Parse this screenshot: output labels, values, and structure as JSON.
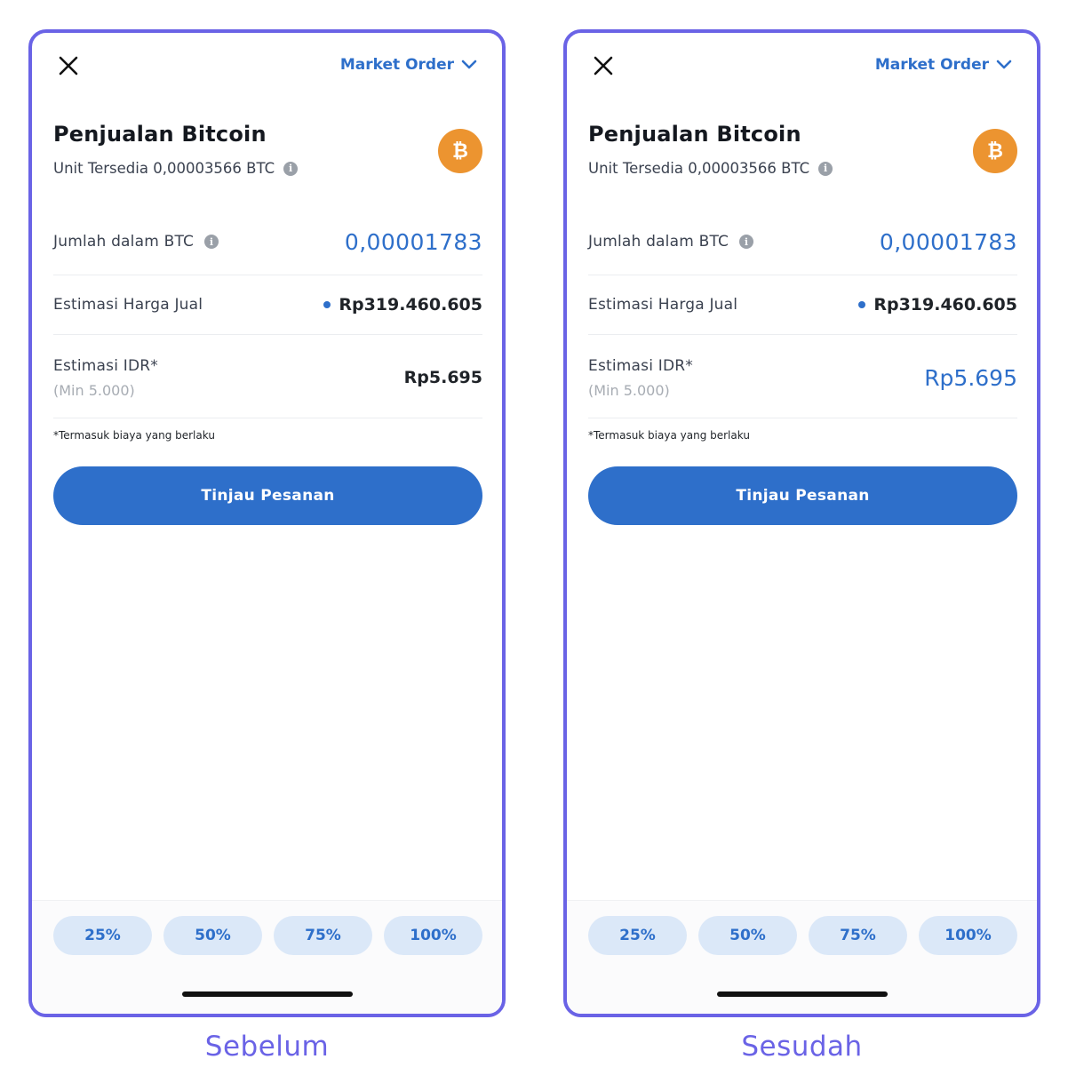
{
  "screens": [
    {
      "caption": "Sebelum",
      "order_type": "Market Order",
      "title": "Penjualan Bitcoin",
      "available_units": "Unit Tersedia 0,00003566 BTC",
      "coin_logo_symbol": "₿",
      "amount_label": "Jumlah dalam BTC",
      "amount_value": "0,00001783",
      "price_label": "Estimasi Harga Jual",
      "price_value": "Rp319.460.605",
      "idr_label": "Estimasi IDR*",
      "idr_min": "(Min 5.000)",
      "idr_value": "Rp5.695",
      "footnote": "*Termasuk biaya yang berlaku",
      "review_button": "Tinjau Pesanan",
      "percent_options": [
        "25%",
        "50%",
        "75%",
        "100%"
      ]
    },
    {
      "caption": "Sesudah",
      "order_type": "Market Order",
      "title": "Penjualan Bitcoin",
      "available_units": "Unit Tersedia 0,00003566 BTC",
      "coin_logo_symbol": "₿",
      "amount_label": "Jumlah dalam BTC",
      "amount_value": "0,00001783",
      "price_label": "Estimasi Harga Jual",
      "price_value": "Rp319.460.605",
      "idr_label": "Estimasi IDR*",
      "idr_min": "(Min 5.000)",
      "idr_value": "Rp5.695",
      "footnote": "*Termasuk biaya yang berlaku",
      "review_button": "Tinjau Pesanan",
      "percent_options": [
        "25%",
        "50%",
        "75%",
        "100%"
      ]
    }
  ],
  "colors": {
    "accent_blue": "#2e6fca",
    "frame_purple": "#6a63e6",
    "bitcoin_orange": "#ec9430",
    "percent_chip_bg": "#dbe8f8"
  },
  "icons": [
    "close-icon",
    "chevron-down-icon",
    "info-icon",
    "bitcoin-icon"
  ]
}
